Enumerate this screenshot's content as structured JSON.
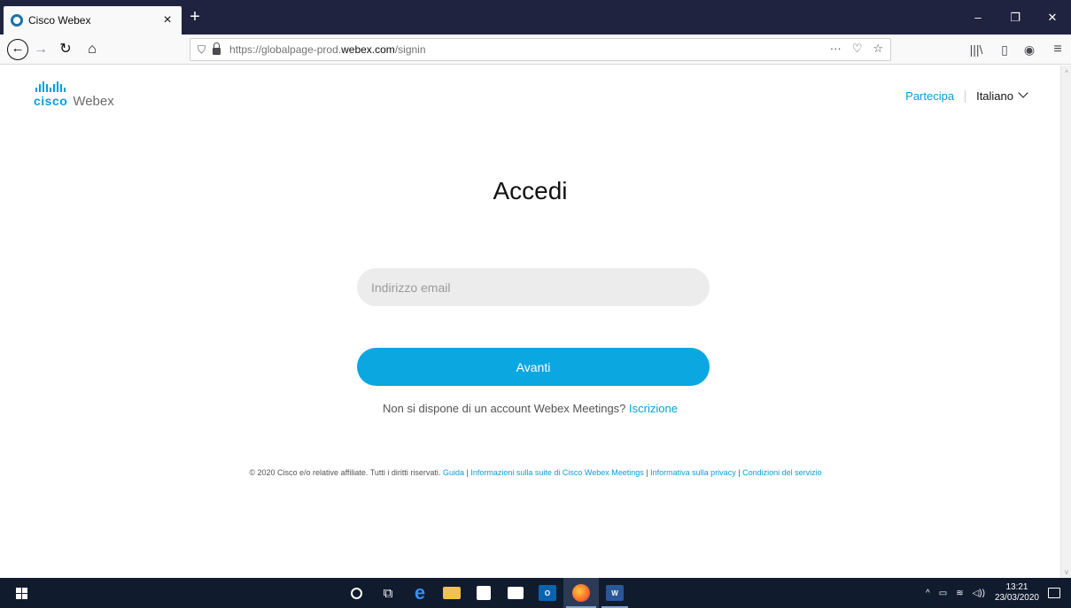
{
  "browser": {
    "tab_title": "Cisco Webex",
    "tab_close": "×",
    "new_tab": "+",
    "window_controls": {
      "minimize": "–",
      "maximize": "❐",
      "close": "✕"
    },
    "nav": {
      "back": "←",
      "forward": "→",
      "reload": "↻",
      "home": "⌂"
    },
    "url_prefix": "https://globalpage-prod.",
    "url_domain": "webex.com",
    "url_suffix": "/signin",
    "url_actions": {
      "more": "···",
      "pocket": "♡",
      "bookmark": "☆"
    },
    "toolbar": {
      "library": "|||\\",
      "sidebar": "▯",
      "account": "◉",
      "menu": "≡"
    }
  },
  "page": {
    "logo_cisco": "cisco",
    "logo_webex": "Webex",
    "join_link": "Partecipa",
    "language": "Italiano",
    "heading": "Accedi",
    "email_placeholder": "Indirizzo email",
    "next_button": "Avanti",
    "signup_text": "Non si dispone di un account Webex Meetings?",
    "signup_link": "Iscrizione",
    "footer": {
      "copyright": "© 2020 Cisco e/o relative affiliate. Tutti i diritti riservati.",
      "links": [
        "Guida",
        "Informazioni sulla suite di Cisco Webex Meetings",
        "Informativa sulla privacy",
        "Condizioni del servizio"
      ]
    }
  },
  "taskbar": {
    "apps": [
      "start",
      "search",
      "task-view",
      "edge",
      "file-explorer",
      "store",
      "mail",
      "outlook",
      "firefox",
      "word"
    ],
    "clock_time": "13:21",
    "clock_date": "23/03/2020",
    "tray_icons": [
      "^",
      "▭",
      "≋",
      "◁))"
    ]
  },
  "colors": {
    "accent": "#049fd9",
    "button": "#0ba7e1",
    "tab_strip": "#202340",
    "taskbar": "#101b2e"
  }
}
